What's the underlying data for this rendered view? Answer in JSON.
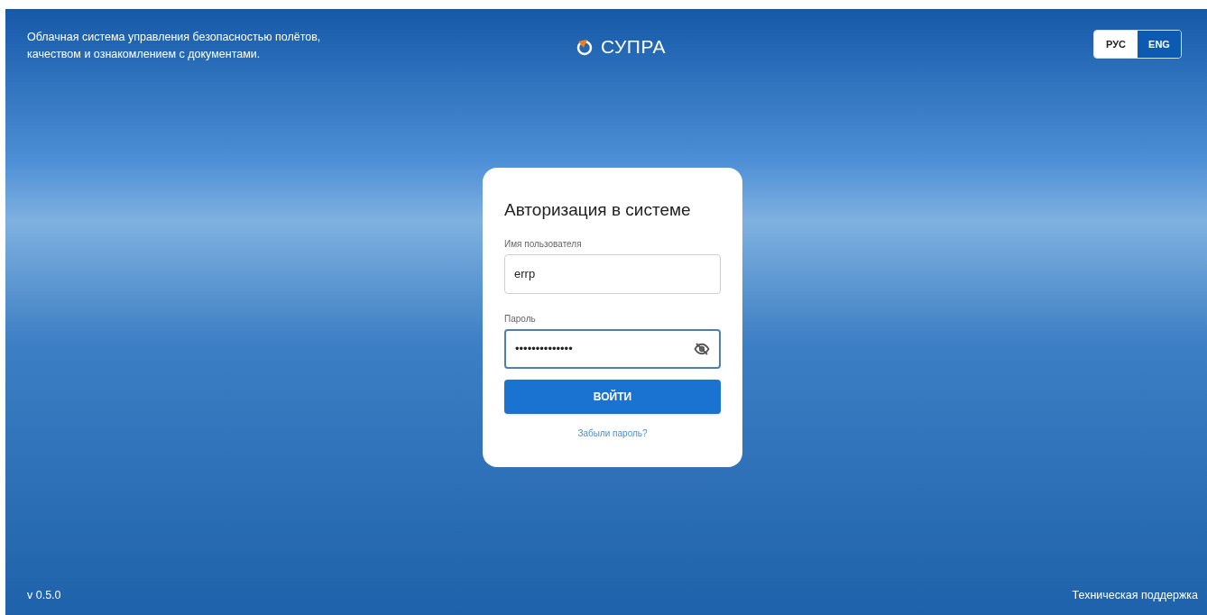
{
  "tagline": "Облачная система управления безопасностью полётов, качеством и ознакомлением с документами.",
  "logo": {
    "text": "СУПРА"
  },
  "languages": [
    {
      "label": "РУС",
      "selected": true
    },
    {
      "label": "ENG",
      "selected": false
    }
  ],
  "login": {
    "title": "Авторизация в системе",
    "username": {
      "label": "Имя пользователя",
      "value": "errp"
    },
    "password": {
      "label": "Пароль",
      "value": "••••••••••••••",
      "focused": true
    },
    "submit": "ВОЙТИ",
    "forgot": "Забыли пароль?"
  },
  "version": "v 0.5.0",
  "support": "Техническая поддержка"
}
